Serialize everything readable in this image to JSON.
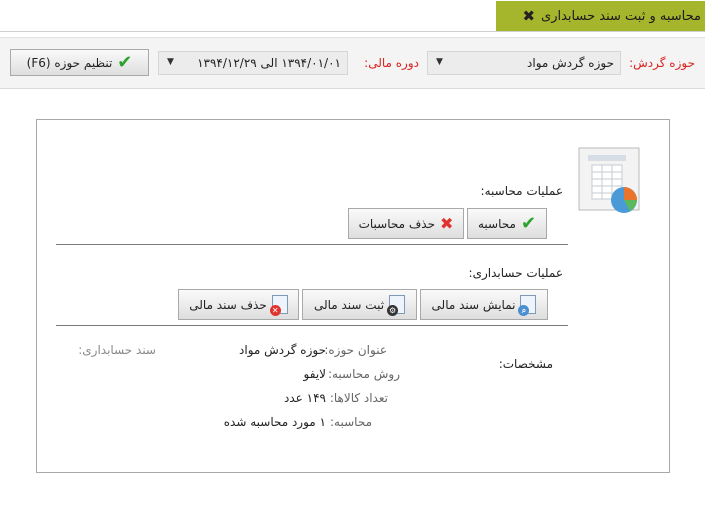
{
  "tab": {
    "title": "محاسبه و ثبت سند حسابداری",
    "close_icon": "close-icon"
  },
  "toolbar": {
    "period_label": "حوزه گردش:",
    "period_value": "حوزه گردش مواد",
    "fiscal_label": "دوره مالی:",
    "fiscal_value": "۱۳۹۴/۰۱/۰۱ الی ۱۳۹۴/۱۲/۲۹",
    "set_period_label": "تنظیم حوزه (F6)"
  },
  "calc": {
    "title": "عملیات محاسبه:",
    "calculate_label": "محاسبه",
    "delete_label": "حذف محاسبات"
  },
  "accounting": {
    "title": "عملیات حسابداری:",
    "show_label": "نمایش سند مالی",
    "register_label": "ثبت سند مالی",
    "delete_label": "حذف سند مالی"
  },
  "details": {
    "title": "مشخصات:",
    "period_title_label": "عنوان حوزه:",
    "period_title_value": "حوزه گردش مواد",
    "method_label": "روش محاسبه:",
    "method_value": "لایفو",
    "items_count_label": "تعداد کالاها:",
    "items_count_value": "۱۴۹ عدد",
    "calc_label": "محاسبه:",
    "calc_value": "۱ مورد محاسبه شده",
    "voucher_label": "سند حسابداری:"
  },
  "colors": {
    "tab": "#a5b52c",
    "required_label": "#d9231f",
    "check": "#2ea22c"
  }
}
